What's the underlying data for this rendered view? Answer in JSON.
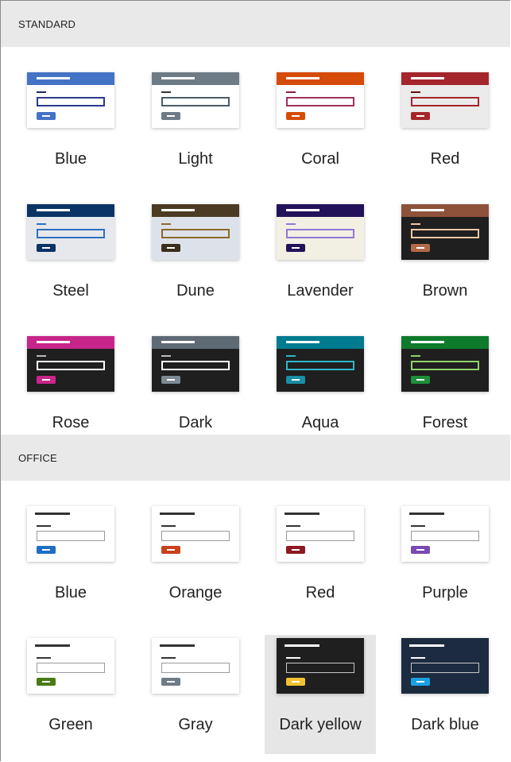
{
  "standard": {
    "header": "STANDARD",
    "themes": [
      {
        "name": "Blue",
        "hdr": "#4472c4",
        "body": "#ffffff",
        "hdrline": "#ffffff",
        "lbl": "#1f2a5a",
        "box": "#2b3a8a",
        "btn": "#4472c4"
      },
      {
        "name": "Light",
        "hdr": "#6d7b86",
        "body": "#ffffff",
        "hdrline": "#ffffff",
        "lbl": "#333333",
        "box": "#4b5c69",
        "btn": "#6d7b86"
      },
      {
        "name": "Coral",
        "hdr": "#d54b09",
        "body": "#ffffff",
        "hdrline": "#ffffff",
        "lbl": "#8a1b4a",
        "box": "#a03060",
        "btn": "#d54b09"
      },
      {
        "name": "Red",
        "hdr": "#a4262c",
        "body": "#ebebeb",
        "hdrline": "#ffffff",
        "lbl": "#6b0f14",
        "box": "#a4262c",
        "btn": "#a4262c"
      },
      {
        "name": "Steel",
        "hdr": "#0a3466",
        "body": "#e6e8ec",
        "hdrline": "#ffffff",
        "lbl": "#2f6fbf",
        "box": "#2f6fbf",
        "btn": "#0a3466"
      },
      {
        "name": "Dune",
        "hdr": "#4b3b22",
        "body": "#dde2ea",
        "hdrline": "#ffffff",
        "lbl": "#8a6a2a",
        "box": "#8a6a2a",
        "btn": "#3c2f19"
      },
      {
        "name": "Lavender",
        "hdr": "#22125a",
        "body": "#f2efe3",
        "hdrline": "#ffffff",
        "lbl": "#8f78d6",
        "box": "#8f78d6",
        "btn": "#22125a"
      },
      {
        "name": "Brown",
        "hdr": "#8e513a",
        "body": "#1f1f1f",
        "hdrline": "#ffffff",
        "lbl": "#f1c9a5",
        "box": "#f1c9a5",
        "btn": "#b06a48"
      },
      {
        "name": "Rose",
        "hdr": "#c8258b",
        "body": "#1f1f1f",
        "hdrline": "#ffffff",
        "lbl": "#bbbbbb",
        "box": "#ffffff",
        "btn": "#c8258b"
      },
      {
        "name": "Dark",
        "hdr": "#5f6b74",
        "body": "#1f1f1f",
        "hdrline": "#ffffff",
        "lbl": "#bbbbbb",
        "box": "#ffffff",
        "btn": "#7b8a95"
      },
      {
        "name": "Aqua",
        "hdr": "#007b8f",
        "body": "#1f1f1f",
        "hdrline": "#ffffff",
        "lbl": "#2fb6c8",
        "box": "#2fb6c8",
        "btn": "#1a8ea3"
      },
      {
        "name": "Forest",
        "hdr": "#0e7a2c",
        "body": "#1f1f1f",
        "hdrline": "#ffffff",
        "lbl": "#8fd16a",
        "box": "#8fd16a",
        "btn": "#1e8f3a"
      }
    ]
  },
  "office": {
    "header": "OFFICE",
    "themes": [
      {
        "name": "Blue",
        "hdr": "#ffffff",
        "body": "#ffffff",
        "hdrline": "#333333",
        "lbl": "#333333",
        "box": "#9a9a9a",
        "btn": "#1e6fc4",
        "selected": false
      },
      {
        "name": "Orange",
        "hdr": "#ffffff",
        "body": "#ffffff",
        "hdrline": "#333333",
        "lbl": "#333333",
        "box": "#9a9a9a",
        "btn": "#c9411a",
        "selected": false
      },
      {
        "name": "Red",
        "hdr": "#ffffff",
        "body": "#ffffff",
        "hdrline": "#333333",
        "lbl": "#333333",
        "box": "#9a9a9a",
        "btn": "#8c1a20",
        "selected": false
      },
      {
        "name": "Purple",
        "hdr": "#ffffff",
        "body": "#ffffff",
        "hdrline": "#333333",
        "lbl": "#333333",
        "box": "#9a9a9a",
        "btn": "#7a4ab3",
        "selected": false
      },
      {
        "name": "Green",
        "hdr": "#ffffff",
        "body": "#ffffff",
        "hdrline": "#333333",
        "lbl": "#333333",
        "box": "#9a9a9a",
        "btn": "#4a7a14",
        "selected": false
      },
      {
        "name": "Gray",
        "hdr": "#ffffff",
        "body": "#ffffff",
        "hdrline": "#333333",
        "lbl": "#333333",
        "box": "#9a9a9a",
        "btn": "#6d7b86",
        "selected": false
      },
      {
        "name": "Dark yellow",
        "hdr": "#1f1f1f",
        "body": "#1f1f1f",
        "hdrline": "#ffffff",
        "lbl": "#ffffff",
        "box": "#c8c8c8",
        "btn": "#f2c232",
        "selected": true
      },
      {
        "name": "Dark blue",
        "hdr": "#1c2b40",
        "body": "#1c2b40",
        "hdrline": "#ffffff",
        "lbl": "#ffffff",
        "box": "#c8c8c8",
        "btn": "#1aa0e0",
        "selected": false
      }
    ]
  }
}
